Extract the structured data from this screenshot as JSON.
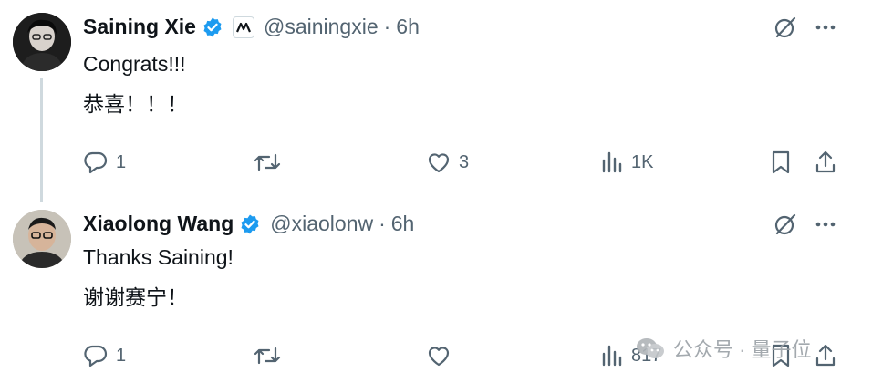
{
  "tweets": [
    {
      "author": {
        "name": "Saining Xie",
        "handle": "@sainingxie",
        "verified": true,
        "affiliate_badge": "nyu-icon"
      },
      "time": "6h",
      "separator": "·",
      "lines": [
        "Congrats!!!",
        "恭喜！！！"
      ],
      "actions": {
        "replies": "1",
        "retweets": "",
        "likes": "3",
        "views": "1K"
      }
    },
    {
      "author": {
        "name": "Xiaolong Wang",
        "handle": "@xiaolonw",
        "verified": true
      },
      "time": "6h",
      "separator": "·",
      "lines": [
        "Thanks Saining!",
        "谢谢赛宁！"
      ],
      "actions": {
        "replies": "1",
        "retweets": "",
        "likes": "",
        "views": "817"
      }
    }
  ],
  "watermark": {
    "text": "公众号 · 量子位",
    "icon": "wechat-icon"
  },
  "colors": {
    "text": "#0f1419",
    "secondary": "#536471",
    "verified": "#1d9bf0",
    "thread_line": "#cfd9de"
  }
}
